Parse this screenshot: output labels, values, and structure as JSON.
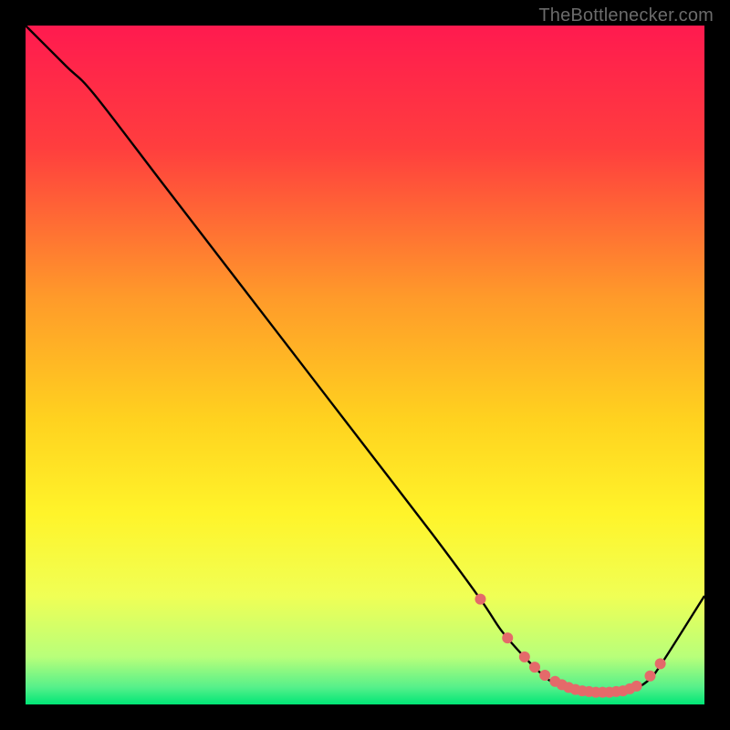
{
  "attribution": "TheBottlenecker.com",
  "chart_data": {
    "type": "line",
    "title": "",
    "xlabel": "",
    "ylabel": "",
    "xlim": [
      0,
      100
    ],
    "ylim": [
      0,
      100
    ],
    "series": [
      {
        "name": "curve",
        "x": [
          0,
          6,
          10,
          20,
          30,
          40,
          50,
          60,
          67,
          70,
          73,
          76,
          78,
          80,
          82,
          84,
          86,
          88,
          90,
          92,
          94,
          100
        ],
        "y": [
          100,
          94,
          90,
          77,
          64,
          51,
          38,
          25,
          15.5,
          11,
          7.5,
          4.5,
          3,
          2.2,
          1.8,
          1.6,
          1.6,
          1.8,
          2.4,
          3.8,
          6.5,
          16
        ]
      }
    ],
    "markers": {
      "name": "dots",
      "x": [
        67,
        71,
        73.5,
        75,
        76.5,
        78,
        79,
        80,
        81,
        82,
        83,
        84,
        85,
        86,
        87,
        88,
        89,
        90,
        92,
        93.5
      ],
      "y": [
        15.5,
        9.8,
        7.0,
        5.5,
        4.3,
        3.4,
        2.9,
        2.5,
        2.2,
        2.0,
        1.9,
        1.8,
        1.8,
        1.8,
        1.9,
        2.0,
        2.3,
        2.7,
        4.2,
        6.0
      ]
    },
    "gradient_stops": [
      {
        "pos": 0.0,
        "color": "#ff1a4f"
      },
      {
        "pos": 0.18,
        "color": "#ff3e3e"
      },
      {
        "pos": 0.4,
        "color": "#ff9a2a"
      },
      {
        "pos": 0.58,
        "color": "#ffd21f"
      },
      {
        "pos": 0.72,
        "color": "#fff42a"
      },
      {
        "pos": 0.84,
        "color": "#f0ff55"
      },
      {
        "pos": 0.93,
        "color": "#b8ff7a"
      },
      {
        "pos": 0.975,
        "color": "#55f08a"
      },
      {
        "pos": 1.0,
        "color": "#00e676"
      }
    ],
    "curve_color": "#000000",
    "marker_color": "#e46a6a",
    "marker_radius": 6
  }
}
